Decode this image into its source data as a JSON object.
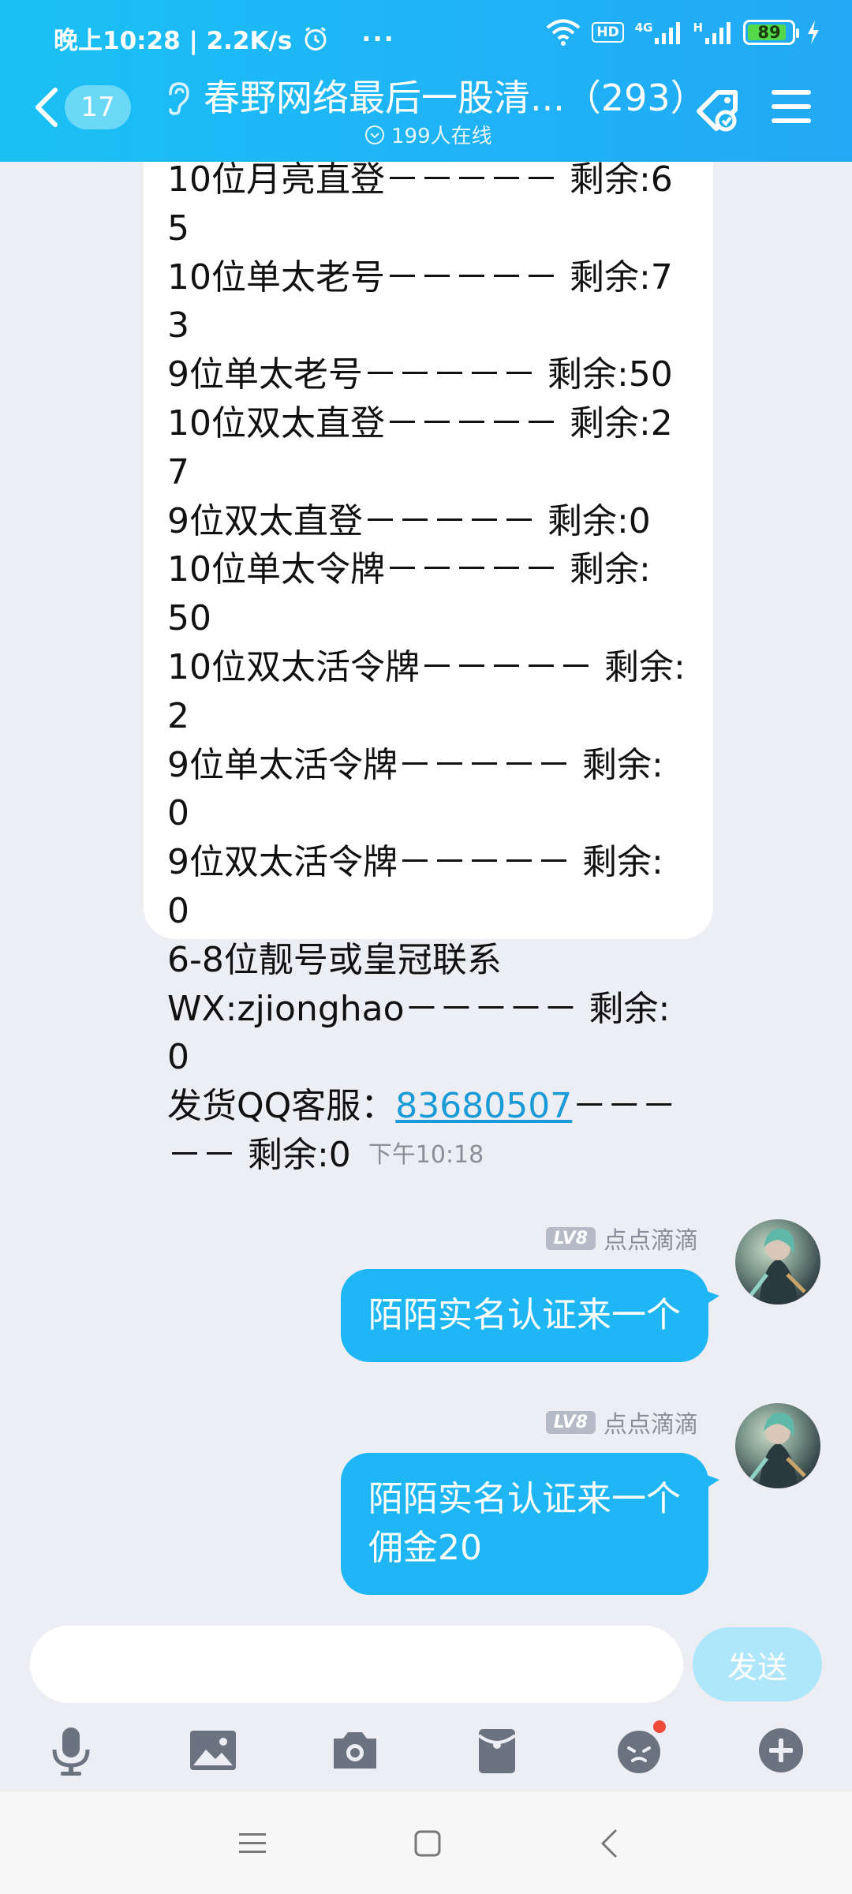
{
  "status_bar": {
    "time_speed": "晚上10:28 | 2.2K/s",
    "dots": "···",
    "hd": "HD",
    "net1": "4G",
    "net2": "H",
    "battery": "89"
  },
  "header": {
    "unread_count": "17",
    "title": "春野网络最后一股清...（293）",
    "online": "199人在线"
  },
  "stock_message": {
    "lines": [
      "10位月亮直登－－－－－ 剩余:65",
      "10位单太老号－－－－－ 剩余:73",
      "9位单太老号－－－－－ 剩余:50",
      "10位双太直登－－－－－ 剩余:27",
      "9位双太直登－－－－－ 剩余:0",
      "10位单太令牌－－－－－ 剩余:",
      "50",
      "10位双太活令牌－－－－－ 剩余:",
      "2",
      "9位单太活令牌－－－－－ 剩余:",
      "0",
      "9位双太活令牌－－－－－ 剩余:",
      "0",
      "6-8位靓号或皇冠联系",
      "WX:zjionghao－－－－－ 剩余:",
      "0"
    ],
    "service_prefix": "发货QQ客服：",
    "service_qq": "83680507",
    "service_suffix": "－－－",
    "last_line": "－－ 剩余:0"
  },
  "timestamp": "下午10:18",
  "messages": [
    {
      "level": "LV8",
      "sender": "点点滴滴",
      "lines": [
        "陌陌实名认证来一个"
      ]
    },
    {
      "level": "LV8",
      "sender": "点点滴滴",
      "lines": [
        "陌陌实名认证来一个",
        "佣金20"
      ]
    }
  ],
  "input": {
    "placeholder": "",
    "send_label": "发送"
  },
  "colors": {
    "accent": "#1fb6f5",
    "link": "#1a9ad6",
    "badge_dot": "#f04a3a"
  },
  "toolbar_icons": [
    "microphone-icon",
    "image-icon",
    "camera-icon",
    "red-packet-icon",
    "emoji-icon",
    "plus-icon"
  ]
}
